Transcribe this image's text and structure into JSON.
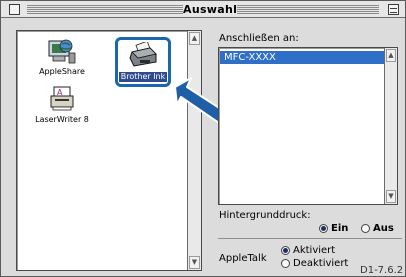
{
  "window": {
    "title": "Auswahl"
  },
  "devices": {
    "items": [
      {
        "label": "AppleShare",
        "icon": "appleshare-icon"
      },
      {
        "label": "Brother Ink",
        "icon": "printer-icon",
        "selected": true
      },
      {
        "label": "LaserWriter 8",
        "icon": "laserwriter-icon"
      }
    ]
  },
  "connect": {
    "label": "Anschließen an:",
    "selected_port": "MFC-XXXX"
  },
  "background_print": {
    "label": "Hintergrunddruck:",
    "on_label": "Ein",
    "off_label": "Aus",
    "value": "Ein"
  },
  "appletalk": {
    "label": "AppleTalk",
    "active_label": "Aktiviert",
    "inactive_label": "Deaktiviert",
    "value": "Aktiviert"
  },
  "version": "D1-7.6.2",
  "colors": {
    "selection": "#2f6fc7",
    "highlight_ring": "#1a67ac",
    "arrow": "#1f5fa8"
  }
}
